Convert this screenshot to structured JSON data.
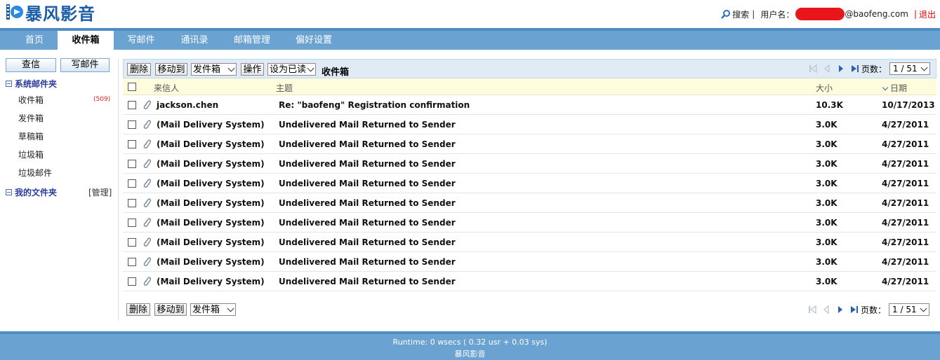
{
  "app": {
    "logo_text": "暴风影音"
  },
  "topbar": {
    "search_label": "搜索",
    "user_label": "用户名：",
    "user_email_suffix": "@baofeng.com",
    "logout_label": "退出"
  },
  "nav": {
    "tabs": [
      {
        "label": "首页"
      },
      {
        "label": "收件箱"
      },
      {
        "label": "写邮件"
      },
      {
        "label": "通讯录"
      },
      {
        "label": "邮箱管理"
      },
      {
        "label": "偏好设置"
      }
    ],
    "active": "收件箱"
  },
  "sidebar": {
    "check_mail_button": "查信",
    "compose_button": "写邮件",
    "system_folders_title": "系统邮件夹",
    "folders": [
      {
        "label": "收件箱",
        "count": "(509)"
      },
      {
        "label": "发件箱"
      },
      {
        "label": "草稿箱"
      },
      {
        "label": "垃圾箱"
      },
      {
        "label": "垃圾邮件"
      }
    ],
    "my_folders_title": "我的文件夹",
    "manage_label": "[管理]"
  },
  "toolbar": {
    "delete_label": "删除",
    "move_to_label": "移动到",
    "move_target_selected": "发件箱",
    "operate_label": "操作",
    "mark_selected": "设为已读",
    "current_folder": "收件箱",
    "pages_label": "页数：",
    "page_selected": "1 / 51"
  },
  "columns": {
    "from": "来信人",
    "subject": "主题",
    "size": "大小",
    "date": "日期"
  },
  "messages": [
    {
      "from": "jackson.chen",
      "subject": "Re: \"baofeng\" Registration confirmation",
      "size": "10.3K",
      "date": "10/17/2013"
    },
    {
      "from": "(Mail Delivery System)",
      "subject": "Undelivered Mail Returned to Sender",
      "size": "3.0K",
      "date": "4/27/2011"
    },
    {
      "from": "(Mail Delivery System)",
      "subject": "Undelivered Mail Returned to Sender",
      "size": "3.0K",
      "date": "4/27/2011"
    },
    {
      "from": "(Mail Delivery System)",
      "subject": "Undelivered Mail Returned to Sender",
      "size": "3.0K",
      "date": "4/27/2011"
    },
    {
      "from": "(Mail Delivery System)",
      "subject": "Undelivered Mail Returned to Sender",
      "size": "3.0K",
      "date": "4/27/2011"
    },
    {
      "from": "(Mail Delivery System)",
      "subject": "Undelivered Mail Returned to Sender",
      "size": "3.0K",
      "date": "4/27/2011"
    },
    {
      "from": "(Mail Delivery System)",
      "subject": "Undelivered Mail Returned to Sender",
      "size": "3.0K",
      "date": "4/27/2011"
    },
    {
      "from": "(Mail Delivery System)",
      "subject": "Undelivered Mail Returned to Sender",
      "size": "3.0K",
      "date": "4/27/2011"
    },
    {
      "from": "(Mail Delivery System)",
      "subject": "Undelivered Mail Returned to Sender",
      "size": "3.0K",
      "date": "4/27/2011"
    },
    {
      "from": "(Mail Delivery System)",
      "subject": "Undelivered Mail Returned to Sender",
      "size": "3.0K",
      "date": "4/27/2011"
    }
  ],
  "footer": {
    "runtime": "Runtime: 0 wsecs ( 0.32 usr + 0.03 sys)",
    "brand": "暴风影音"
  },
  "colors": {
    "nav_bg": "#6aa2d2",
    "accent": "#1a5ea8",
    "logout": "#dd0000",
    "header_row_bg": "#fdfcdc"
  }
}
